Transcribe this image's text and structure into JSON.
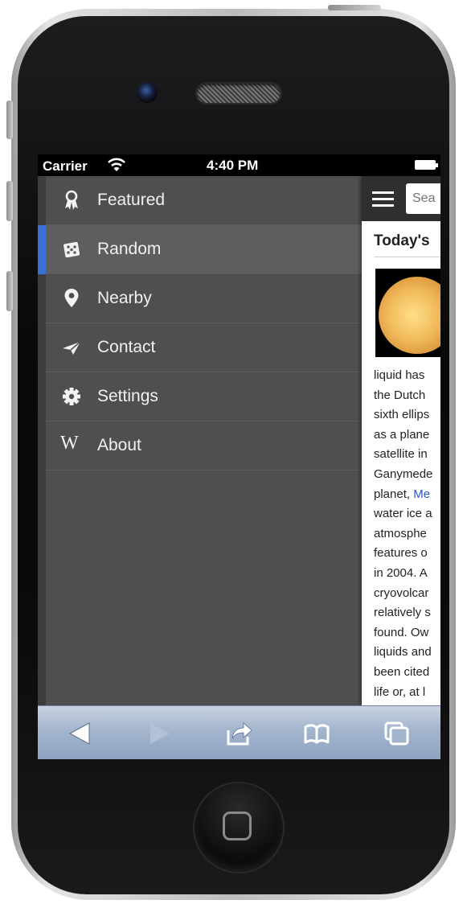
{
  "status_bar": {
    "carrier": "Carrier",
    "time": "4:40 PM"
  },
  "menu": {
    "items": [
      {
        "label": "Featured",
        "icon": "ribbon-icon",
        "active": false
      },
      {
        "label": "Random",
        "icon": "dice-icon",
        "active": true
      },
      {
        "label": "Nearby",
        "icon": "map-pin-icon",
        "active": false
      },
      {
        "label": "Contact",
        "icon": "paper-plane-icon",
        "active": false
      },
      {
        "label": "Settings",
        "icon": "gear-icon",
        "active": false
      },
      {
        "label": "About",
        "icon": "wikipedia-w-icon",
        "active": false
      }
    ],
    "accent_color": "#3a6fd3"
  },
  "content": {
    "search_placeholder": "Sea",
    "section_title": "Today's",
    "lines": [
      "liquid has",
      "the Dutch",
      "sixth ellips",
      "as a plane",
      "satellite in",
      "Ganymede",
      {
        "before": "planet, ",
        "link": "Me"
      },
      "water ice a",
      "atmosphe",
      "features o",
      "in 2004. A",
      "cryovolcar",
      "relatively s",
      "found. Ow",
      "liquids and",
      "been cited",
      "life or, at l"
    ]
  },
  "toolbar": {
    "buttons": [
      "back-icon",
      "forward-icon",
      "share-icon",
      "bookmarks-icon",
      "tabs-icon"
    ]
  }
}
